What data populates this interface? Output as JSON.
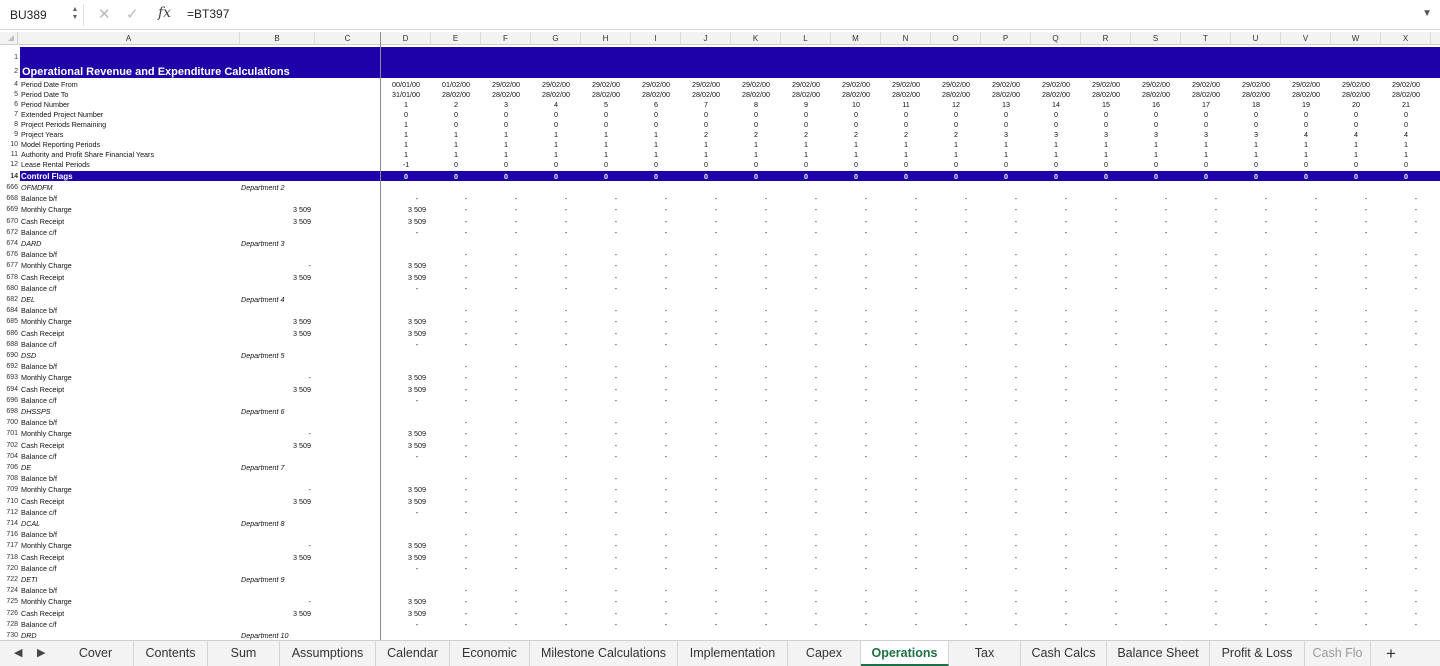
{
  "formula_bar": {
    "cell_ref": "BU389",
    "formula": "=BT397",
    "cancel_icon": "cancel-x-icon",
    "confirm_icon": "checkmark-icon",
    "fx_label": "fx"
  },
  "columns": [
    "A",
    "B",
    "C",
    "D",
    "E",
    "F",
    "G",
    "H",
    "I",
    "J",
    "K",
    "L",
    "M",
    "N",
    "O",
    "P",
    "Q",
    "R",
    "S",
    "T",
    "U",
    "V",
    "W",
    "X"
  ],
  "header_rows": [
    {
      "n": "1",
      "label": ""
    },
    {
      "n": "2",
      "label": ""
    },
    {
      "n": "4",
      "label": "Period Date From"
    },
    {
      "n": "5",
      "label": "Period Date To"
    },
    {
      "n": "6",
      "label": "Period Number"
    },
    {
      "n": "7",
      "label": "Extended Project Number"
    },
    {
      "n": "8",
      "label": "Project Periods Remaining"
    },
    {
      "n": "9",
      "label": "Project Years"
    },
    {
      "n": "10",
      "label": "Model Reporting Periods"
    },
    {
      "n": "11",
      "label": "Authority and Profit Share Financial Years"
    },
    {
      "n": "12",
      "label": "Lease Rental Periods"
    },
    {
      "n": "14",
      "label": ""
    }
  ],
  "sheet_title": "Operational Revenue and Expenditure Calculations",
  "control_flags": "Control Flags",
  "date_from": [
    "00/01/00",
    "01/02/00",
    "29/02/00",
    "29/02/00",
    "29/02/00",
    "29/02/00",
    "29/02/00",
    "29/02/00",
    "29/02/00",
    "29/02/00",
    "29/02/00",
    "29/02/00",
    "29/02/00",
    "29/02/00",
    "29/02/00",
    "29/02/00",
    "29/02/00",
    "29/02/00",
    "29/02/00",
    "29/02/00",
    "29/02/00"
  ],
  "date_to": [
    "31/01/00",
    "28/02/00",
    "28/02/00",
    "28/02/00",
    "28/02/00",
    "28/02/00",
    "28/02/00",
    "28/02/00",
    "28/02/00",
    "28/02/00",
    "28/02/00",
    "28/02/00",
    "28/02/00",
    "28/02/00",
    "28/02/00",
    "28/02/00",
    "28/02/00",
    "28/02/00",
    "28/02/00",
    "28/02/00",
    "28/02/00"
  ],
  "period_number": [
    "1",
    "2",
    "3",
    "4",
    "5",
    "6",
    "7",
    "8",
    "9",
    "10",
    "11",
    "12",
    "13",
    "14",
    "15",
    "16",
    "17",
    "18",
    "19",
    "20",
    "21"
  ],
  "extended_project_number": [
    "0",
    "0",
    "0",
    "0",
    "0",
    "0",
    "0",
    "0",
    "0",
    "0",
    "0",
    "0",
    "0",
    "0",
    "0",
    "0",
    "0",
    "0",
    "0",
    "0",
    "0"
  ],
  "project_periods_remaining": [
    "1",
    "0",
    "0",
    "0",
    "0",
    "0",
    "0",
    "0",
    "0",
    "0",
    "0",
    "0",
    "0",
    "0",
    "0",
    "0",
    "0",
    "0",
    "0",
    "0",
    "0"
  ],
  "project_years": [
    "1",
    "1",
    "1",
    "1",
    "1",
    "1",
    "2",
    "2",
    "2",
    "2",
    "2",
    "2",
    "3",
    "3",
    "3",
    "3",
    "3",
    "3",
    "4",
    "4",
    "4"
  ],
  "model_reporting_periods": [
    "1",
    "1",
    "1",
    "1",
    "1",
    "1",
    "1",
    "1",
    "1",
    "1",
    "1",
    "1",
    "1",
    "1",
    "1",
    "1",
    "1",
    "1",
    "1",
    "1",
    "1"
  ],
  "authority_financial_years": [
    "1",
    "1",
    "1",
    "1",
    "1",
    "1",
    "1",
    "1",
    "1",
    "1",
    "1",
    "1",
    "1",
    "1",
    "1",
    "1",
    "1",
    "1",
    "1",
    "1",
    "1"
  ],
  "lease_rental_periods": [
    "-1",
    "0",
    "0",
    "0",
    "0",
    "0",
    "0",
    "0",
    "0",
    "0",
    "0",
    "0",
    "0",
    "0",
    "0",
    "0",
    "0",
    "0",
    "0",
    "0",
    "0"
  ],
  "control_flags_row": [
    "0",
    "0",
    "0",
    "0",
    "0",
    "0",
    "0",
    "0",
    "0",
    "0",
    "0",
    "0",
    "0",
    "0",
    "0",
    "0",
    "0",
    "0",
    "0",
    "0",
    "0"
  ],
  "dash": "-",
  "monthly_value": "3 509",
  "body_rows": [
    {
      "n": "666",
      "a": "OFMDFM",
      "b": "Department 2",
      "italic": true,
      "partial": true
    },
    {
      "n": "668",
      "a": "Balance b/f",
      "d": "-",
      "dashes": true
    },
    {
      "n": "669",
      "a": "Monthly Charge",
      "c": "3 509",
      "d": "3 509",
      "dashes": true
    },
    {
      "n": "670",
      "a": "Cash Receipt",
      "c": "3 509",
      "d": "3 509",
      "dashes": true
    },
    {
      "n": "672",
      "a": "Balance c/f",
      "d": "-",
      "dashes": true
    },
    {
      "n": "674",
      "a": "DARD",
      "b": "Department 3",
      "italic": true
    },
    {
      "n": "676",
      "a": "Balance b/f",
      "dashes": true
    },
    {
      "n": "677",
      "a": "Monthly Charge",
      "c": "-",
      "d": "3 509",
      "dashes": true
    },
    {
      "n": "678",
      "a": "Cash Receipt",
      "c": "3 509",
      "d": "3 509",
      "dashes": true
    },
    {
      "n": "680",
      "a": "Balance c/f",
      "d": "-",
      "dashes": true
    },
    {
      "n": "682",
      "a": "DEL",
      "b": "Department 4",
      "italic": true
    },
    {
      "n": "684",
      "a": "Balance b/f",
      "dashes": true
    },
    {
      "n": "685",
      "a": "Monthly Charge",
      "c": "3 509",
      "d": "3 509",
      "dashes": true
    },
    {
      "n": "686",
      "a": "Cash Receipt",
      "c": "3 509",
      "d": "3 509",
      "dashes": true
    },
    {
      "n": "688",
      "a": "Balance c/f",
      "d": "-",
      "dashes": true
    },
    {
      "n": "690",
      "a": "DSD",
      "b": "Department 5",
      "italic": true
    },
    {
      "n": "692",
      "a": "Balance b/f",
      "dashes": true
    },
    {
      "n": "693",
      "a": "Monthly Charge",
      "c": "-",
      "d": "3 509",
      "dashes": true
    },
    {
      "n": "694",
      "a": "Cash Receipt",
      "c": "3 509",
      "d": "3 509",
      "dashes": true
    },
    {
      "n": "696",
      "a": "Balance c/f",
      "d": "-",
      "dashes": true
    },
    {
      "n": "698",
      "a": "DHSSPS",
      "b": "Department 6",
      "italic": true
    },
    {
      "n": "700",
      "a": "Balance b/f",
      "dashes": true
    },
    {
      "n": "701",
      "a": "Monthly Charge",
      "c": "-",
      "d": "3 509",
      "dashes": true
    },
    {
      "n": "702",
      "a": "Cash Receipt",
      "c": "3 509",
      "d": "3 509",
      "dashes": true
    },
    {
      "n": "704",
      "a": "Balance c/f",
      "d": "-",
      "dashes": true
    },
    {
      "n": "706",
      "a": "DE",
      "b": "Department 7",
      "italic": true
    },
    {
      "n": "708",
      "a": "Balance b/f",
      "dashes": true
    },
    {
      "n": "709",
      "a": "Monthly Charge",
      "c": "-",
      "d": "3 509",
      "dashes": true
    },
    {
      "n": "710",
      "a": "Cash Receipt",
      "c": "3 509",
      "d": "3 509",
      "dashes": true
    },
    {
      "n": "712",
      "a": "Balance c/f",
      "d": "-",
      "dashes": true
    },
    {
      "n": "714",
      "a": "DCAL",
      "b": "Department 8",
      "italic": true
    },
    {
      "n": "716",
      "a": "Balance b/f",
      "dashes": true
    },
    {
      "n": "717",
      "a": "Monthly Charge",
      "c": "-",
      "d": "3 509",
      "dashes": true
    },
    {
      "n": "718",
      "a": "Cash Receipt",
      "c": "3 509",
      "d": "3 509",
      "dashes": true
    },
    {
      "n": "720",
      "a": "Balance c/f",
      "d": "-",
      "dashes": true
    },
    {
      "n": "722",
      "a": "DETI",
      "b": "Department 9",
      "italic": true
    },
    {
      "n": "724",
      "a": "Balance b/f",
      "dashes": true
    },
    {
      "n": "725",
      "a": "Monthly Charge",
      "c": "-",
      "d": "3 509",
      "dashes": true
    },
    {
      "n": "726",
      "a": "Cash Receipt",
      "c": "3 509",
      "d": "3 509",
      "dashes": true
    },
    {
      "n": "728",
      "a": "Balance c/f",
      "d": "-",
      "dashes": true
    },
    {
      "n": "730",
      "a": "DRD",
      "b": "Department 10",
      "italic": true
    }
  ],
  "tabs": [
    "Cover",
    "Contents",
    "Sum",
    "Assumptions",
    "Calendar",
    "Economic",
    "Milestone Calculations",
    "Implementation",
    "Capex",
    "Operations",
    "Tax",
    "Cash Calcs",
    "Balance Sheet",
    "Profit & Loss",
    "Cash Flo"
  ],
  "active_tab": "Operations",
  "add_tab": "+",
  "colors": {
    "banner": "#1e01a8",
    "active_tab": "#1d7044"
  }
}
